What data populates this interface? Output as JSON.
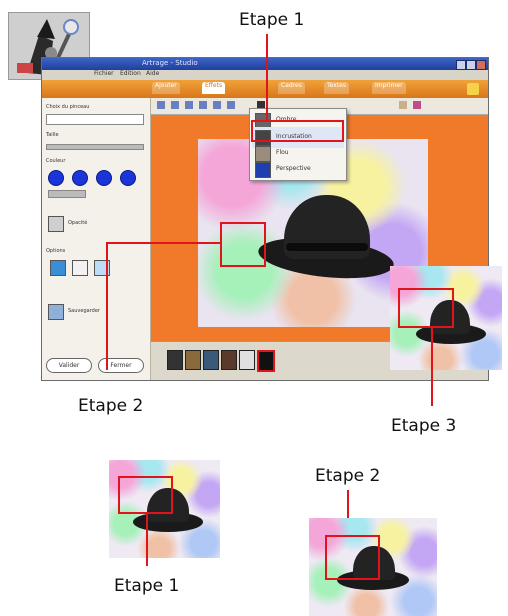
{
  "annotations": {
    "top_step": "Etape 1",
    "left_step": "Etape 2",
    "right_step": "Etape 3",
    "bottom_left_step": "Etape 1",
    "bottom_right_step": "Etape 2"
  },
  "app": {
    "window_title": "Artrage - Studio",
    "menu": [
      "Fichier",
      "Edition",
      "Aide"
    ],
    "tabs": [
      "Ajouter",
      "Effets",
      "Cadres",
      "Textes",
      "Imprimer"
    ],
    "sidebar": {
      "brush_label": "Choix du pinceau",
      "size_label": "Taille",
      "color_label": "Couleur",
      "opacity_label": "Opacité",
      "option_label": "Options",
      "bottom_label": "Sauvegarder",
      "save_button": "Valider",
      "cancel_button": "Fermer"
    },
    "dropdown": {
      "items": [
        "Ombre",
        "Incrustation",
        "Flou",
        "Perspective"
      ]
    }
  }
}
